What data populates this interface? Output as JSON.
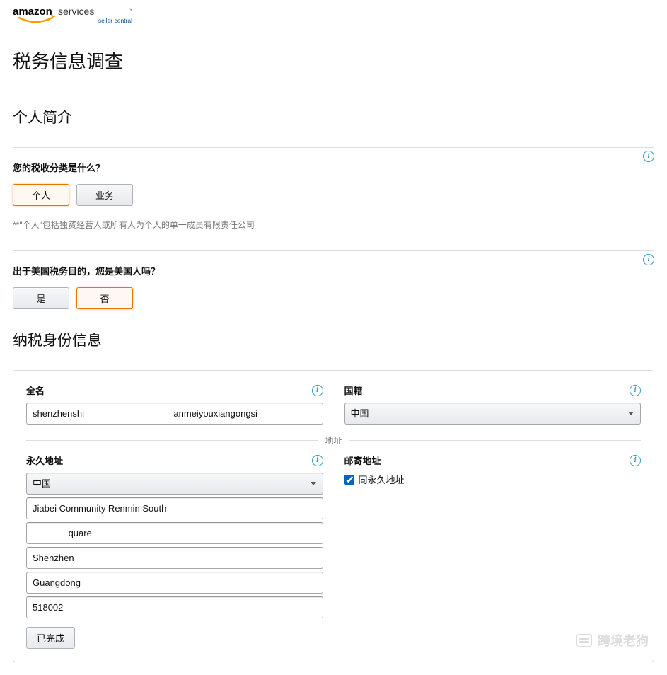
{
  "logo": {
    "brand_top": "amazon services",
    "brand_sub": "seller central"
  },
  "page_title": "税务信息调查",
  "profile_heading": "个人简介",
  "q1": {
    "label": "您的税收分类是什么？",
    "option_individual": "个人",
    "option_business": "业务",
    "note": "**\"个人\"包括独资经营人或所有人为个人的单一成员有限责任公司"
  },
  "q2": {
    "label": "出于美国税务目的，您是美国人吗？",
    "option_yes": "是",
    "option_no": "否"
  },
  "identity_heading": "纳税身份信息",
  "fullname": {
    "label": "全名",
    "value": "shenzhenshi                                   anmeiyouxiangongsi"
  },
  "nationality": {
    "label": "国籍",
    "value": "中国"
  },
  "address_divider": "地址",
  "perm_addr": {
    "label": "永久地址",
    "country": "中国",
    "line1": "Jiabei Community Renmin South",
    "line2": "              quare",
    "city": "Shenzhen",
    "province": "Guangdong",
    "postal": "518002",
    "done_label": "已完成"
  },
  "mail_addr": {
    "label": "邮寄地址",
    "same_label": "同永久地址",
    "same_checked": true
  },
  "watermark_text": "跨境老狗"
}
